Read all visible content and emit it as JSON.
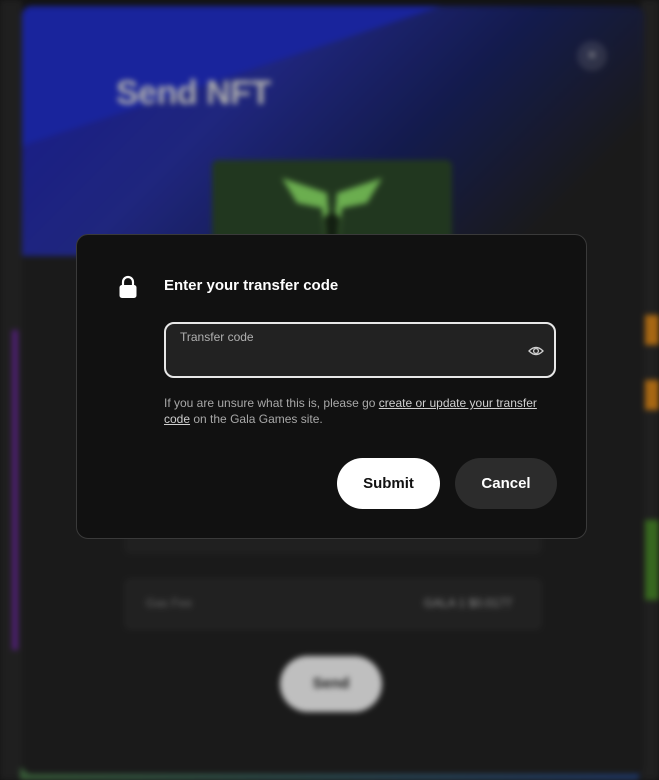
{
  "background": {
    "modal_title": "Send NFT",
    "close_glyph": "×",
    "gas_fee_label": "Gas Fee",
    "gas_fee_value": "GALA 1 $0.0177",
    "send_button": "Send",
    "accent_color": "#1e22b8"
  },
  "dialog": {
    "title": "Enter your transfer code",
    "lock_icon": "lock-icon",
    "field": {
      "label": "Transfer code",
      "value": "",
      "visibility_icon": "eye-icon"
    },
    "help": {
      "prefix": "If you are unsure what this is, please go ",
      "link_text": "create or update your transfer code",
      "suffix": " on the Gala Games site."
    },
    "submit_label": "Submit",
    "cancel_label": "Cancel"
  }
}
